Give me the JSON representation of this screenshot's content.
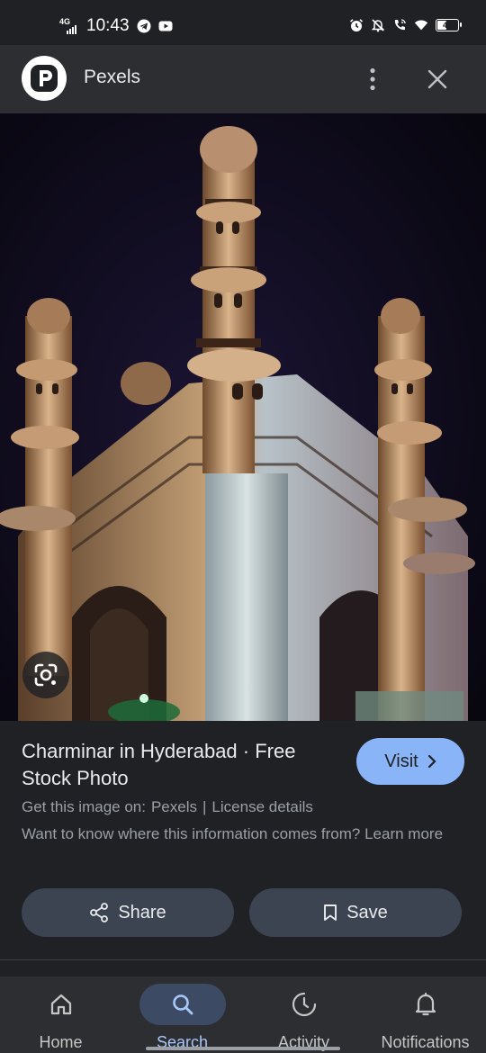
{
  "status_bar": {
    "network": "4G",
    "time": "10:43",
    "battery": "48",
    "battery_level": 0.48,
    "left_icons": [
      "telegram-icon",
      "youtube-icon"
    ],
    "right_icons": [
      "alarm-icon",
      "mute-icon",
      "wifi-calling-icon",
      "wifi-icon",
      "battery-icon"
    ]
  },
  "header": {
    "site_name": "Pexels",
    "logo_icon": "pexels-logo",
    "more_icon": "more-vert-icon",
    "close_icon": "close-icon"
  },
  "image": {
    "subject": "charminar-photo",
    "lens_icon": "google-lens-icon"
  },
  "info": {
    "title": "Charminar in Hyderabad · Free Stock Photo",
    "visit_label": "Visit",
    "source_prefix": "Get this image on:",
    "source_name": "Pexels",
    "separator": "|",
    "license_link": "License details",
    "info_text": "Want to know where this information comes from?",
    "learn_more": "Learn more"
  },
  "actions": {
    "share_label": "Share",
    "save_label": "Save"
  },
  "bottom_nav": {
    "items": [
      {
        "label": "Home",
        "icon": "home-icon",
        "active": false
      },
      {
        "label": "Search",
        "icon": "search-icon",
        "active": true
      },
      {
        "label": "Activity",
        "icon": "activity-icon",
        "active": false
      },
      {
        "label": "Notifications",
        "icon": "bell-icon",
        "active": false
      }
    ]
  },
  "colors": {
    "background": "#202124",
    "header": "#2d2e31",
    "accent": "#8ab4f8",
    "button": "#3c4452",
    "active_nav": "#3d4a63"
  }
}
